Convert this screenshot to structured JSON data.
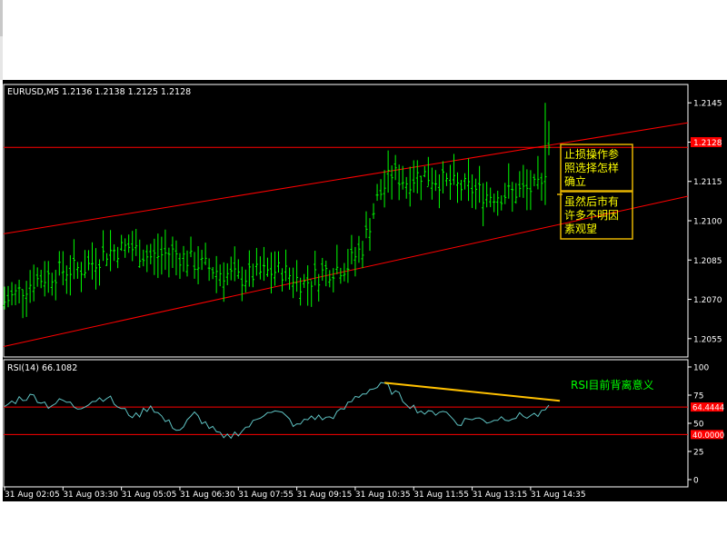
{
  "window": {
    "symbol_header": "EURUSD,M5  1.2136 1.2138 1.2125 1.2128",
    "rsi_header": "RSI(14)  66.1082",
    "current_price_label": "1.2128"
  },
  "colors": {
    "background": "#000000",
    "outer_background": "#ffffff",
    "candle": "#00ff00",
    "channel_line": "#ff0000",
    "hline": "#ff0000",
    "rsi_line": "#5fc3c3",
    "rsi_trendline": "#ffc000",
    "annotation_box_border": "#e6b400",
    "annotation_text": "#ffff00",
    "rsi_annotation_text": "#00ff00",
    "axis_text": "#ffffff",
    "axis_line": "#ffffff",
    "price_label_bg": "#ff0000"
  },
  "annotations": {
    "box1": [
      "止损操作参",
      "照选择怎样",
      "确立"
    ],
    "box2": [
      "虽然后市有",
      "许多不明因",
      "素观望"
    ],
    "rsi_note": "RSI目前背离意义"
  },
  "chart_data": {
    "type": "ohlc",
    "symbol": "EURUSD",
    "timeframe": "M5",
    "ohlc_header": {
      "open": 1.2136,
      "high": 1.2138,
      "low": 1.2125,
      "close": 1.2128
    },
    "price_axis": {
      "ylim": [
        1.2048,
        1.2152
      ],
      "ticks": [
        "1.2145",
        "1.2130",
        "1.2115",
        "1.2100",
        "1.2085",
        "1.2070",
        "1.2055"
      ],
      "tick_values": [
        1.2145,
        1.213,
        1.2115,
        1.21,
        1.2085,
        1.207,
        1.2055
      ],
      "current_price": 1.2128
    },
    "time_axis": {
      "labels": [
        "31 Aug 02:05",
        "31 Aug 03:30",
        "31 Aug 05:05",
        "31 Aug 06:30",
        "31 Aug 07:55",
        "31 Aug 09:15",
        "31 Aug 10:35",
        "31 Aug 11:55",
        "31 Aug 13:15",
        "31 Aug 14:35"
      ],
      "label_bar_index": [
        0,
        16,
        32,
        48,
        64,
        80,
        96,
        112,
        128,
        144
      ]
    },
    "bar_count": 150,
    "close_anchors": [
      {
        "bar": 0,
        "close": 1.2069
      },
      {
        "bar": 8,
        "close": 1.2077
      },
      {
        "bar": 16,
        "close": 1.2081
      },
      {
        "bar": 22,
        "close": 1.2082
      },
      {
        "bar": 28,
        "close": 1.2088
      },
      {
        "bar": 34,
        "close": 1.209
      },
      {
        "bar": 40,
        "close": 1.2086
      },
      {
        "bar": 46,
        "close": 1.2088
      },
      {
        "bar": 52,
        "close": 1.2084
      },
      {
        "bar": 58,
        "close": 1.2081
      },
      {
        "bar": 64,
        "close": 1.2078
      },
      {
        "bar": 70,
        "close": 1.208
      },
      {
        "bar": 76,
        "close": 1.2081
      },
      {
        "bar": 82,
        "close": 1.2076
      },
      {
        "bar": 88,
        "close": 1.2081
      },
      {
        "bar": 94,
        "close": 1.2083
      },
      {
        "bar": 98,
        "close": 1.209
      },
      {
        "bar": 102,
        "close": 1.2108
      },
      {
        "bar": 106,
        "close": 1.2118
      },
      {
        "bar": 110,
        "close": 1.2115
      },
      {
        "bar": 114,
        "close": 1.2118
      },
      {
        "bar": 118,
        "close": 1.2116
      },
      {
        "bar": 124,
        "close": 1.2113
      },
      {
        "bar": 128,
        "close": 1.2112
      },
      {
        "bar": 132,
        "close": 1.211
      },
      {
        "bar": 136,
        "close": 1.211
      },
      {
        "bar": 140,
        "close": 1.2111
      },
      {
        "bar": 144,
        "close": 1.2112
      },
      {
        "bar": 147,
        "close": 1.2112
      },
      {
        "bar": 149,
        "close": 1.2128
      }
    ],
    "spike_high": {
      "bar": 148,
      "high": 1.2145,
      "low": 1.2106
    },
    "horizontal_line": {
      "price": 1.2128
    },
    "channel": {
      "upper": {
        "x0": 0,
        "y0": 1.2095,
        "x1": 150,
        "y1": 1.2129
      },
      "lower": {
        "x0": 0,
        "y0": 1.2052,
        "x1": 150,
        "y1": 1.2098
      }
    },
    "rsi": {
      "period": 14,
      "value": 66.1082,
      "ylim": [
        0,
        100
      ],
      "ticks": [
        "100",
        "75",
        "50",
        "25",
        "0"
      ],
      "tick_values": [
        100,
        75,
        50,
        25,
        0
      ],
      "levels": [
        "64.4444",
        "40.0000"
      ],
      "level_values": [
        64.4444,
        40.0
      ],
      "anchors": [
        {
          "bar": 0,
          "value": 65
        },
        {
          "bar": 4,
          "value": 72
        },
        {
          "bar": 8,
          "value": 74
        },
        {
          "bar": 12,
          "value": 66
        },
        {
          "bar": 16,
          "value": 70
        },
        {
          "bar": 20,
          "value": 64
        },
        {
          "bar": 24,
          "value": 70
        },
        {
          "bar": 28,
          "value": 74
        },
        {
          "bar": 32,
          "value": 62
        },
        {
          "bar": 36,
          "value": 56
        },
        {
          "bar": 40,
          "value": 66
        },
        {
          "bar": 44,
          "value": 52
        },
        {
          "bar": 48,
          "value": 44
        },
        {
          "bar": 52,
          "value": 58
        },
        {
          "bar": 56,
          "value": 47
        },
        {
          "bar": 60,
          "value": 36
        },
        {
          "bar": 64,
          "value": 42
        },
        {
          "bar": 68,
          "value": 50
        },
        {
          "bar": 72,
          "value": 62
        },
        {
          "bar": 76,
          "value": 58
        },
        {
          "bar": 80,
          "value": 47
        },
        {
          "bar": 84,
          "value": 56
        },
        {
          "bar": 88,
          "value": 54
        },
        {
          "bar": 92,
          "value": 60
        },
        {
          "bar": 96,
          "value": 73
        },
        {
          "bar": 100,
          "value": 80
        },
        {
          "bar": 104,
          "value": 84
        },
        {
          "bar": 108,
          "value": 74
        },
        {
          "bar": 112,
          "value": 64
        },
        {
          "bar": 116,
          "value": 58
        },
        {
          "bar": 120,
          "value": 62
        },
        {
          "bar": 124,
          "value": 50
        },
        {
          "bar": 128,
          "value": 55
        },
        {
          "bar": 132,
          "value": 52
        },
        {
          "bar": 136,
          "value": 55
        },
        {
          "bar": 140,
          "value": 56
        },
        {
          "bar": 144,
          "value": 57
        },
        {
          "bar": 147,
          "value": 58
        },
        {
          "bar": 149,
          "value": 66.1
        }
      ],
      "trendline": {
        "x0": 104,
        "y0": 86,
        "x1": 152,
        "y1": 70
      }
    }
  }
}
